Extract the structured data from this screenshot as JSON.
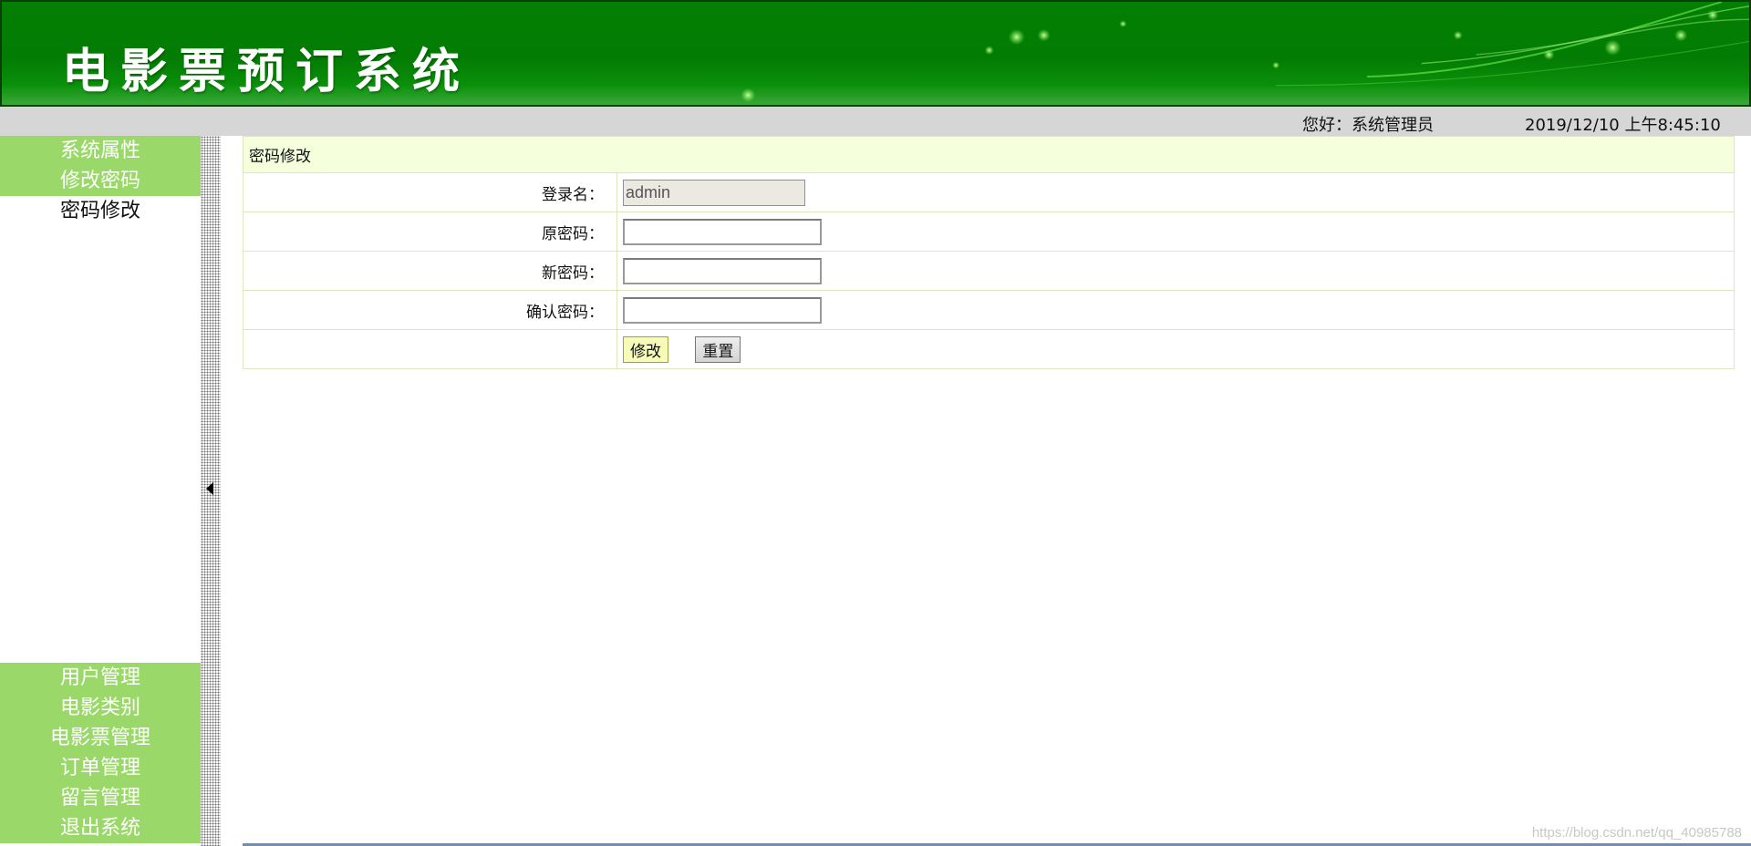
{
  "header": {
    "title": "电影票预订系统"
  },
  "statusbar": {
    "greeting": "您好：系统管理员",
    "datetime": "2019/12/10 上午8:45:10"
  },
  "sidebar": {
    "top_items": [
      {
        "label": "系统属性"
      },
      {
        "label": "修改密码"
      }
    ],
    "active_subitem": {
      "label": "密码修改"
    },
    "bottom_items": [
      {
        "label": "用户管理"
      },
      {
        "label": "电影类别"
      },
      {
        "label": "电影票管理"
      },
      {
        "label": "订单管理"
      },
      {
        "label": "留言管理"
      },
      {
        "label": "退出系统"
      }
    ]
  },
  "form": {
    "title": "密码修改",
    "fields": {
      "login_name": {
        "label": "登录名：",
        "value": "admin"
      },
      "old_password": {
        "label": "原密码：",
        "value": ""
      },
      "new_password": {
        "label": "新密码：",
        "value": ""
      },
      "confirm_password": {
        "label": "确认密码：",
        "value": ""
      }
    },
    "submit_label": "修改",
    "reset_label": "重置"
  },
  "watermark": "https://blog.csdn.net/qq_40985788",
  "colors": {
    "banner_green": "#037f03",
    "sidebar_green": "#9bd86a",
    "form_header_bg": "#f5ffdc",
    "statusbar_gray": "#d6d6d6"
  },
  "icons": {
    "collapse": "caret-left-icon"
  }
}
